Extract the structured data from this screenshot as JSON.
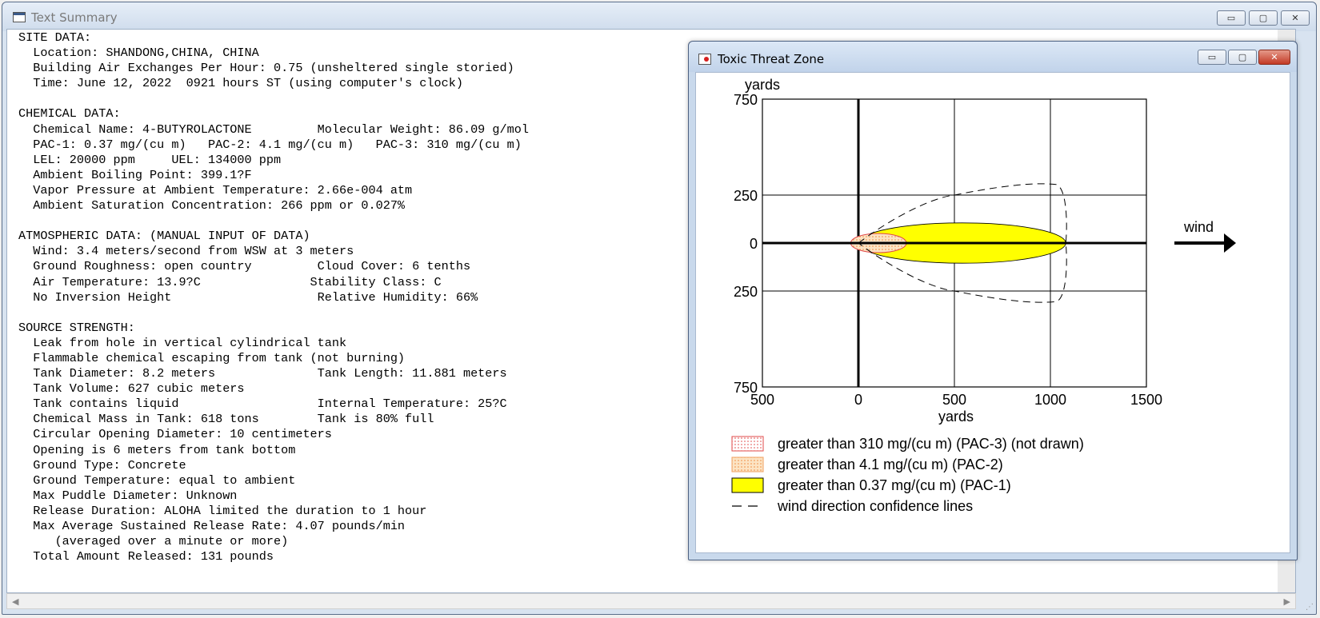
{
  "window": {
    "title": "Text Summary",
    "minimize_label": "▭",
    "maximize_label": "▢",
    "close_label": "✕"
  },
  "summary_lines": [
    "SITE DATA:",
    "  Location: SHANDONG,CHINA, CHINA",
    "  Building Air Exchanges Per Hour: 0.75 (unsheltered single storied)",
    "  Time: June 12, 2022  0921 hours ST (using computer's clock)",
    "",
    "CHEMICAL DATA:",
    "  Chemical Name: 4-BUTYROLACTONE         Molecular Weight: 86.09 g/mol",
    "  PAC-1: 0.37 mg/(cu m)   PAC-2: 4.1 mg/(cu m)   PAC-3: 310 mg/(cu m)",
    "  LEL: 20000 ppm     UEL: 134000 ppm",
    "  Ambient Boiling Point: 399.1?F",
    "  Vapor Pressure at Ambient Temperature: 2.66e-004 atm",
    "  Ambient Saturation Concentration: 266 ppm or 0.027%",
    "",
    "ATMOSPHERIC DATA: (MANUAL INPUT OF DATA)",
    "  Wind: 3.4 meters/second from WSW at 3 meters",
    "  Ground Roughness: open country         Cloud Cover: 6 tenths",
    "  Air Temperature: 13.9?C               Stability Class: C",
    "  No Inversion Height                    Relative Humidity: 66%",
    "",
    "SOURCE STRENGTH:",
    "  Leak from hole in vertical cylindrical tank",
    "  Flammable chemical escaping from tank (not burning)",
    "  Tank Diameter: 8.2 meters              Tank Length: 11.881 meters",
    "  Tank Volume: 627 cubic meters",
    "  Tank contains liquid                   Internal Temperature: 25?C",
    "  Chemical Mass in Tank: 618 tons        Tank is 80% full",
    "  Circular Opening Diameter: 10 centimeters",
    "  Opening is 6 meters from tank bottom",
    "  Ground Type: Concrete",
    "  Ground Temperature: equal to ambient",
    "  Max Puddle Diameter: Unknown",
    "  Release Duration: ALOHA limited the duration to 1 hour",
    "  Max Average Sustained Release Rate: 4.07 pounds/min",
    "     (averaged over a minute or more)",
    "  Total Amount Released: 131 pounds"
  ],
  "threat_window": {
    "title": "Toxic Threat Zone",
    "minimize_label": "▭",
    "maximize_label": "▢",
    "close_label": "✕"
  },
  "chart_data": {
    "type": "area",
    "y_unit_label": "yards",
    "x_unit_label": "yards",
    "x_ticks": [
      "500",
      "0",
      "500",
      "1000",
      "1500"
    ],
    "y_ticks": [
      "750",
      "250",
      "0",
      "250",
      "750"
    ],
    "x_tick_values": [
      -500,
      0,
      500,
      1000,
      1500
    ],
    "y_tick_values": [
      750,
      250,
      0,
      -250,
      -750
    ],
    "xlim": [
      -500,
      1500
    ],
    "ylim": [
      -750,
      750
    ],
    "grid": true,
    "wind_label": "wind",
    "zones": [
      {
        "name": "PAC-1",
        "x_start": 0,
        "x_end": 1080,
        "half_width": 105,
        "color": "#ffff00"
      },
      {
        "name": "PAC-2",
        "x_start": -40,
        "x_end": 250,
        "half_width": 50,
        "color": "#fbd9a8"
      }
    ],
    "confidence_line": {
      "x": [
        0,
        500,
        1000,
        1080,
        1080,
        1000,
        500,
        0
      ],
      "y": [
        0,
        250,
        310,
        200,
        -200,
        -310,
        -250,
        0
      ]
    },
    "legend": [
      {
        "label": "greater than 310 mg/(cu m) (PAC-3) (not drawn)",
        "style": "dotted-red",
        "color": "#e04848"
      },
      {
        "label": "greater than 4.1 mg/(cu m) (PAC-2)",
        "style": "dotted-orange",
        "color": "#f0a060"
      },
      {
        "label": "greater than 0.37 mg/(cu m) (PAC-1)",
        "style": "solid-yellow",
        "color": "#ffff00"
      },
      {
        "label": "wind direction confidence lines",
        "style": "dashed",
        "color": "#000000"
      }
    ]
  }
}
